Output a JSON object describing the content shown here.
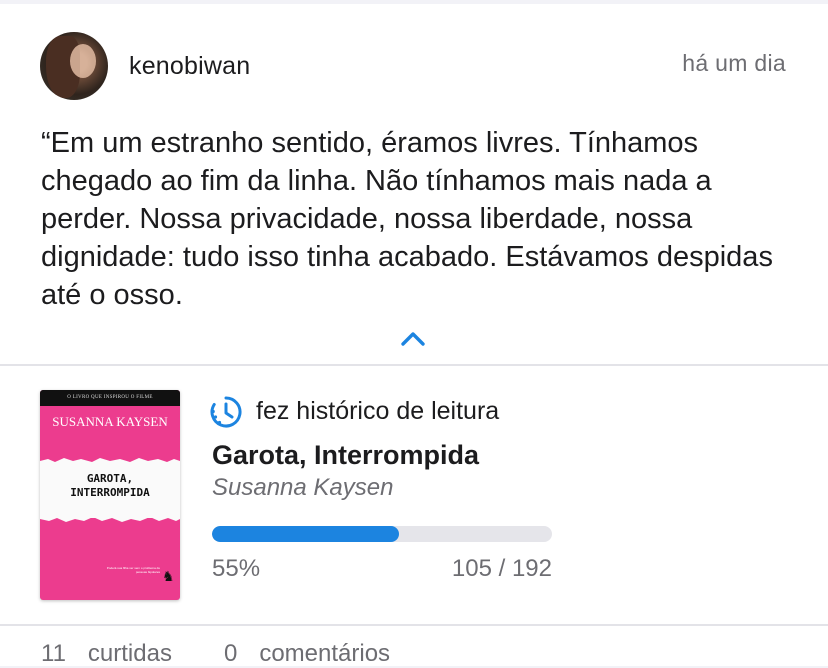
{
  "post": {
    "username": "kenobiwan",
    "time": "há um dia",
    "quote": "“Em um estranho sentido, éramos livres. Tínhamos chegado ao fim da linha. Não tínhamos mais nada a perder. Nossa privacidade, nossa liberdade, nossa dignidade: tudo isso tinha acabado. Estávamos despidas até o osso.",
    "collapse_icon": "chevron-up-icon"
  },
  "reading": {
    "action_icon": "history-clock-icon",
    "action": "fez histórico de leitura",
    "book_title": "Garota, Interrompida",
    "book_author": "Susanna Kaysen",
    "progress_fraction": 0.55,
    "percent": "55%",
    "pages": "105 / 192",
    "cover": {
      "top_text": "O LIVRO QUE INSPIROU O FILME",
      "author": "SUSANNA KAYSEN",
      "title": "GAROTA,\nINTERROMPIDA",
      "blurb": "Poderá sua filha ver sem o problema de pessoas bipolares",
      "logo": "♞",
      "colors": {
        "cover": "#ec3c8e",
        "band": "#111111",
        "paper": "#fafafa"
      }
    }
  },
  "stats": {
    "likes_count": "11",
    "likes_label": "curtidas",
    "comments_count": "0",
    "comments_label": "comentários"
  },
  "colors": {
    "accent": "#1c84e0",
    "text": "#1c1c1e",
    "secondary": "#6d6d72"
  }
}
